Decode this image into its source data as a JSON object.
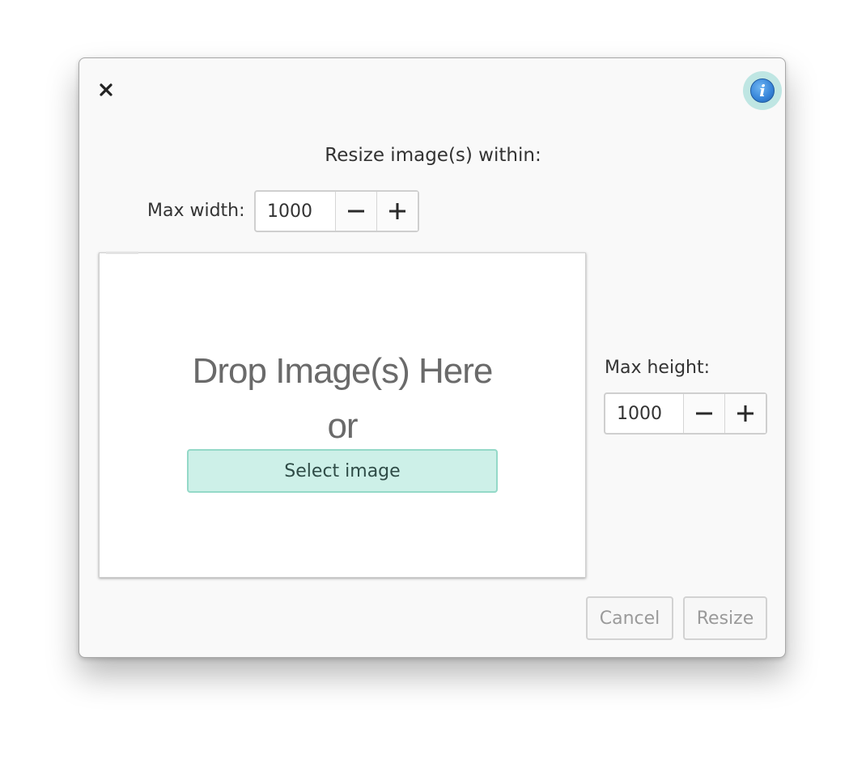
{
  "dialog": {
    "heading": "Resize image(s) within:",
    "close_icon": "close-icon",
    "info_icon": "info-icon",
    "info_glyph": "i",
    "accent_color": "#bfe6e3"
  },
  "max_width": {
    "label": "Max width:",
    "value": "1000",
    "decrement_icon": "minus-icon",
    "increment_icon": "plus-icon"
  },
  "max_height": {
    "label": "Max height:",
    "value": "1000",
    "decrement_icon": "minus-icon",
    "increment_icon": "plus-icon"
  },
  "drop_zone": {
    "line1": "Drop Image(s) Here",
    "line2": "or",
    "select_button": "Select image",
    "select_button_color": "#cdf0e8"
  },
  "actions": {
    "cancel": "Cancel",
    "resize": "Resize"
  }
}
